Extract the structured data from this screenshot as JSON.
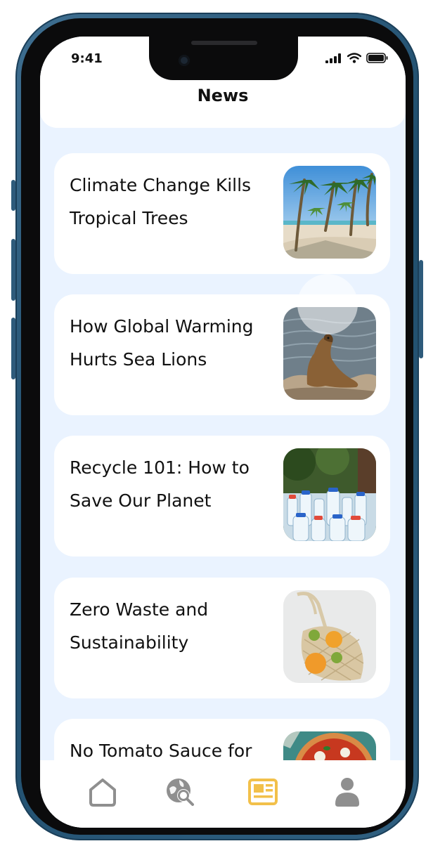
{
  "status_bar": {
    "time": "9:41"
  },
  "header": {
    "title": "News"
  },
  "articles": [
    {
      "title": "Climate Change Kills Tropical Trees",
      "image": "palm-beach-photo"
    },
    {
      "title": "How Global Warming Hurts Sea Lions",
      "image": "sea-lion-photo"
    },
    {
      "title": "Recycle 101: How to Save Our Planet",
      "image": "plastic-bottles-photo"
    },
    {
      "title": "Zero Waste and Sustainability",
      "image": "mesh-bag-oranges-photo"
    },
    {
      "title": "No Tomato Sauce for",
      "image": "pizza-photo"
    }
  ],
  "tab_bar": {
    "items": [
      {
        "icon": "home-icon",
        "active": false
      },
      {
        "icon": "globe-search-icon",
        "active": false
      },
      {
        "icon": "news-icon",
        "active": true
      },
      {
        "icon": "profile-icon",
        "active": false
      }
    ],
    "active_color": "#f2c04a",
    "inactive_color": "#8f8f8f"
  }
}
